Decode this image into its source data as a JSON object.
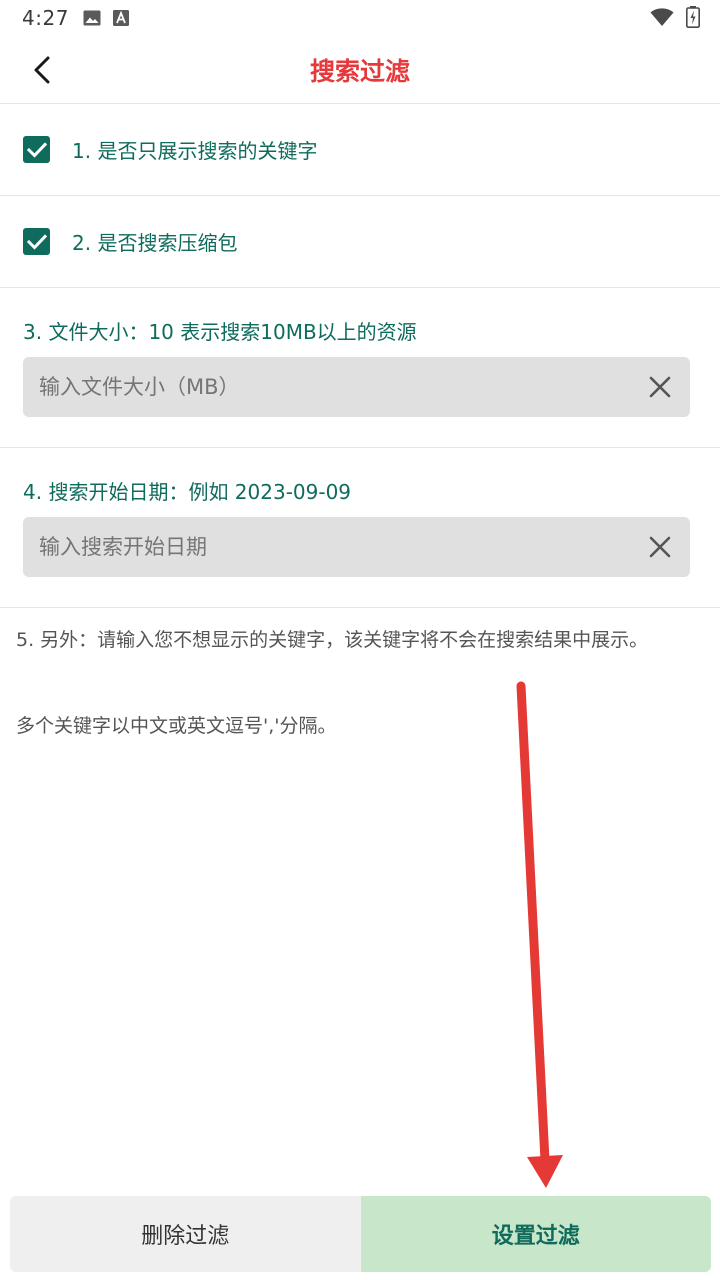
{
  "status_bar": {
    "time": "4:27",
    "icons_left": [
      "image-icon",
      "text-a-icon"
    ],
    "icons_right": [
      "wifi-icon",
      "battery-icon"
    ]
  },
  "header": {
    "title": "搜索过滤",
    "title_color": "#e5393b",
    "back_icon": "chevron-left-icon"
  },
  "options": [
    {
      "label": "1. 是否只展示搜索的关键字",
      "checked": true
    },
    {
      "label": "2. 是否搜索压缩包",
      "checked": true
    }
  ],
  "fields": [
    {
      "label": "3. 文件大小：10 表示搜索10MB以上的资源",
      "value": "",
      "placeholder": "输入文件大小（MB）"
    },
    {
      "label": "4. 搜索开始日期：例如 2023-09-09",
      "value": "",
      "placeholder": "输入搜索开始日期"
    }
  ],
  "notes": {
    "exclude_note": "5. 另外：请输入您不想显示的关键字，该关键字将不会在搜索结果中展示。",
    "separator_note": "多个关键字以中文或英文逗号','分隔。"
  },
  "buttons": {
    "delete_label": "删除过滤",
    "set_label": "设置过滤"
  },
  "colors": {
    "accent": "#0f6b5c",
    "title": "#e5393b",
    "set_button_bg": "#c8e6c9",
    "annotation_arrow": "#e53935"
  }
}
